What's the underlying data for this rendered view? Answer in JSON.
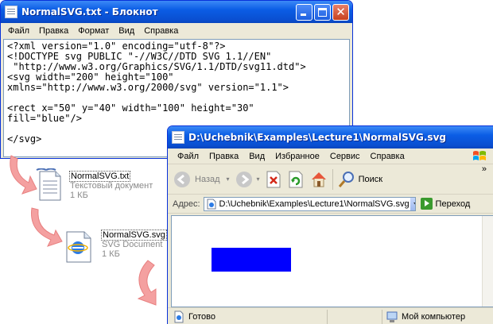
{
  "notepad": {
    "title": "NormalSVG.txt - Блокнот",
    "menu": [
      "Файл",
      "Правка",
      "Формат",
      "Вид",
      "Справка"
    ],
    "content": "<?xml version=\"1.0\" encoding=\"utf-8\"?>\n<!DOCTYPE svg PUBLIC \"-//W3C//DTD SVG 1.1//EN\"\n \"http://www.w3.org/Graphics/SVG/1.1/DTD/svg11.dtd\">\n<svg width=\"200\" height=\"100\"\nxmlns=\"http://www.w3.org/2000/svg\" version=\"1.1\">\n\n<rect x=\"50\" y=\"40\" width=\"100\" height=\"30\"\nfill=\"blue\"/>\n\n</svg>"
  },
  "files": [
    {
      "name": "NormalSVG.txt",
      "type": "Текстовый документ",
      "size": "1 КБ",
      "icon": "text-document-icon"
    },
    {
      "name": "NormalSVG.svg",
      "type": "SVG Document",
      "size": "1 КБ",
      "icon": "svg-document-icon"
    }
  ],
  "explorer": {
    "title": "D:\\Uchebnik\\Examples\\Lecture1\\NormalSVG.svg",
    "menu": [
      "Файл",
      "Правка",
      "Вид",
      "Избранное",
      "Сервис",
      "Справка"
    ],
    "toolbar": {
      "back": "Назад",
      "search": "Поиск",
      "more": "»"
    },
    "address_label": "Адрес:",
    "address_value": "D:\\Uchebnik\\Examples\\Lecture1\\NormalSVG.svg",
    "go_label": "Переход",
    "status_left": "Готово",
    "status_right": "Мой компьютер"
  },
  "colors": {
    "titlebar": "#0a4fd1",
    "rect_fill": "#0000ff",
    "arrow": "#f08080"
  }
}
